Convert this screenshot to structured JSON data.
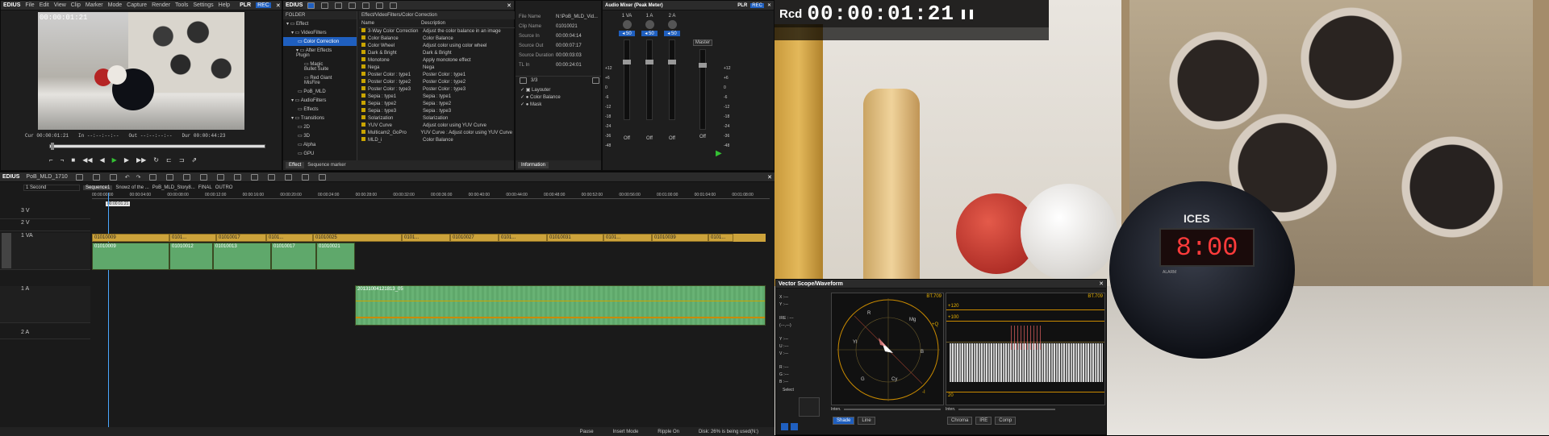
{
  "app": {
    "name": "EDIUS",
    "player_label": "PLR",
    "rec_label": "REC"
  },
  "player": {
    "menu": [
      "File",
      "Edit",
      "View",
      "Clip",
      "Marker",
      "Mode",
      "Capture",
      "Render",
      "Tools",
      "Settings",
      "Help"
    ],
    "overlay_tc": "00:00:01:21",
    "cur_label": "Cur",
    "cur_tc": "00:00:01:21",
    "in_label": "In",
    "in_tc": "--:--:--:--",
    "out_label": "Out",
    "out_tc": "--:--:--:--",
    "dur_label": "Dur",
    "dur_tc": "00:00:44:23"
  },
  "effect": {
    "title": "EDIUS",
    "folder_label": "FOLDER",
    "path": "Effect/VideoFilters/Color Correction",
    "tree": [
      "Effect",
      "VideoFilters",
      "Color Correction",
      "After Effects Plugin",
      "Magic Bullet Suite",
      "Red Giant MisFire",
      "PoB_MLD",
      "AudioFilters",
      "Effects",
      "Transitions",
      "2D",
      "3D",
      "Alpha",
      "GPU"
    ],
    "col_name": "Name",
    "col_desc": "Description",
    "items": [
      {
        "name": "3-Way Color Correction",
        "desc": "Adjust the color balance in an image"
      },
      {
        "name": "Color Balance",
        "desc": "Color Balance"
      },
      {
        "name": "Color Wheel",
        "desc": "Adjust color using color wheel"
      },
      {
        "name": "Dark & Bright",
        "desc": "Dark & Bright"
      },
      {
        "name": "Monotone",
        "desc": "Apply monotone effect"
      },
      {
        "name": "Nega",
        "desc": "Nega"
      },
      {
        "name": "Poster Color : type1",
        "desc": "Poster Color : type1"
      },
      {
        "name": "Poster Color : type2",
        "desc": "Poster Color : type2"
      },
      {
        "name": "Poster Color : type3",
        "desc": "Poster Color : type3"
      },
      {
        "name": "Sepia : type1",
        "desc": "Sepia : type1"
      },
      {
        "name": "Sepia : type2",
        "desc": "Sepia : type2"
      },
      {
        "name": "Sepia : type3",
        "desc": "Sepia : type3"
      },
      {
        "name": "Solarization",
        "desc": "Solarization"
      },
      {
        "name": "YUV Curve",
        "desc": "Adjust color using YUV Curve"
      },
      {
        "name": "Multicam2_GoPro",
        "desc": "YUV Curve : Adjust color using YUV Curve"
      },
      {
        "name": "MLD_i",
        "desc": "Color Balance"
      }
    ],
    "tab_effect": "Effect",
    "tab_marker": "Sequence marker"
  },
  "info": {
    "fields": [
      {
        "label": "File Name",
        "value": "N:\\PoB_MLD_Vid..."
      },
      {
        "label": "Clip Name",
        "value": "01010021"
      },
      {
        "label": "Source In",
        "value": "00:00:04:14"
      },
      {
        "label": "Source Out",
        "value": "00:00:07:17"
      },
      {
        "label": "Source Duration",
        "value": "00:00:03:03"
      },
      {
        "label": "TL In",
        "value": "00:00:24:01"
      }
    ],
    "count": "3/3",
    "filters": [
      "Layouter",
      "Color Balance",
      "Mask"
    ],
    "tab": "Information"
  },
  "mixer": {
    "title": "Audio Mixer (Peak Meter)",
    "channels": [
      "1 VA",
      "1 A",
      "2 A"
    ],
    "master": "Master",
    "pan_values": [
      "50",
      "50",
      "50"
    ],
    "scale": [
      "+12",
      "+6",
      "0",
      "-6",
      "-12",
      "-18",
      "-24",
      "-36",
      "-48"
    ],
    "off_label": "Off"
  },
  "timeline": {
    "title": "EDIUS",
    "project": "PoB_MLD_1710",
    "scale": "1 Second",
    "sequence_tab": "Sequence1",
    "other_tabs": [
      "Snowz of the ...",
      "PoB_MLD_Story8...",
      "FINAL",
      "OUTRO"
    ],
    "ruler": [
      "00:00:00:00",
      "00:00:04:00",
      "00:00:08:00",
      "00:00:12:00",
      "00:00:16:00",
      "00:00:20:00",
      "00:00:24:00",
      "00:00:28:00",
      "00:00:32:00",
      "00:00:36:00",
      "00:00:40:00",
      "00:00:44:00",
      "00:00:48:00",
      "00:00:52:00",
      "00:00:56:00",
      "00:01:00:00",
      "00:01:04:00",
      "00:01:08:00"
    ],
    "cursor_tc": "00:00:01:21",
    "tracks": [
      "3 V",
      "2 V",
      "1 VA",
      "1 A",
      "2 A"
    ],
    "video_clips": [
      "01010009",
      "0101...",
      "01010017",
      "0101...",
      "01010025",
      "0101...",
      "01010027",
      "0101...",
      "01010031",
      "0101...",
      "01010039",
      "0101..."
    ],
    "audio_clips": [
      "01010009",
      "01010012",
      "01010013",
      "01010017",
      "01010021"
    ],
    "long_audio": "20131004121813_05",
    "status": {
      "pause": "Pause",
      "insert": "Insert Mode",
      "ripple": "Ripple On",
      "disk": "Disk: 26% is being used(N:)"
    }
  },
  "recorder": {
    "label": "Rcd",
    "timecode": "00:00:01:21",
    "pause_glyph": "❚❚"
  },
  "clock": {
    "brand": "ICES",
    "time": "8:00",
    "alarm": "ALARM"
  },
  "scope": {
    "title": "Vector Scope/Waveform",
    "left": [
      "X :---",
      "Y :---",
      "IRE : ---",
      "(---,---)",
      "Y :---",
      "U :---",
      "V :---",
      "R :---",
      "G :---",
      "B :---"
    ],
    "select_label": "Select",
    "vs_marks": {
      "preset": "BT.709",
      "R": "R",
      "Mg": "Mg",
      "B": "B",
      "Cy": "Cy",
      "G": "G",
      "Yl": "Yl",
      "Q": "+Q",
      "I": "-I"
    },
    "wf_labels": {
      "preset": "BT.709",
      "h120": "+120",
      "h100": "+100",
      "h20": "20"
    },
    "inten_label": "Inten.",
    "buttons_vs": [
      "Shade",
      "Line"
    ],
    "buttons_wf": [
      "Chroma",
      "IRE",
      "Comp"
    ]
  }
}
